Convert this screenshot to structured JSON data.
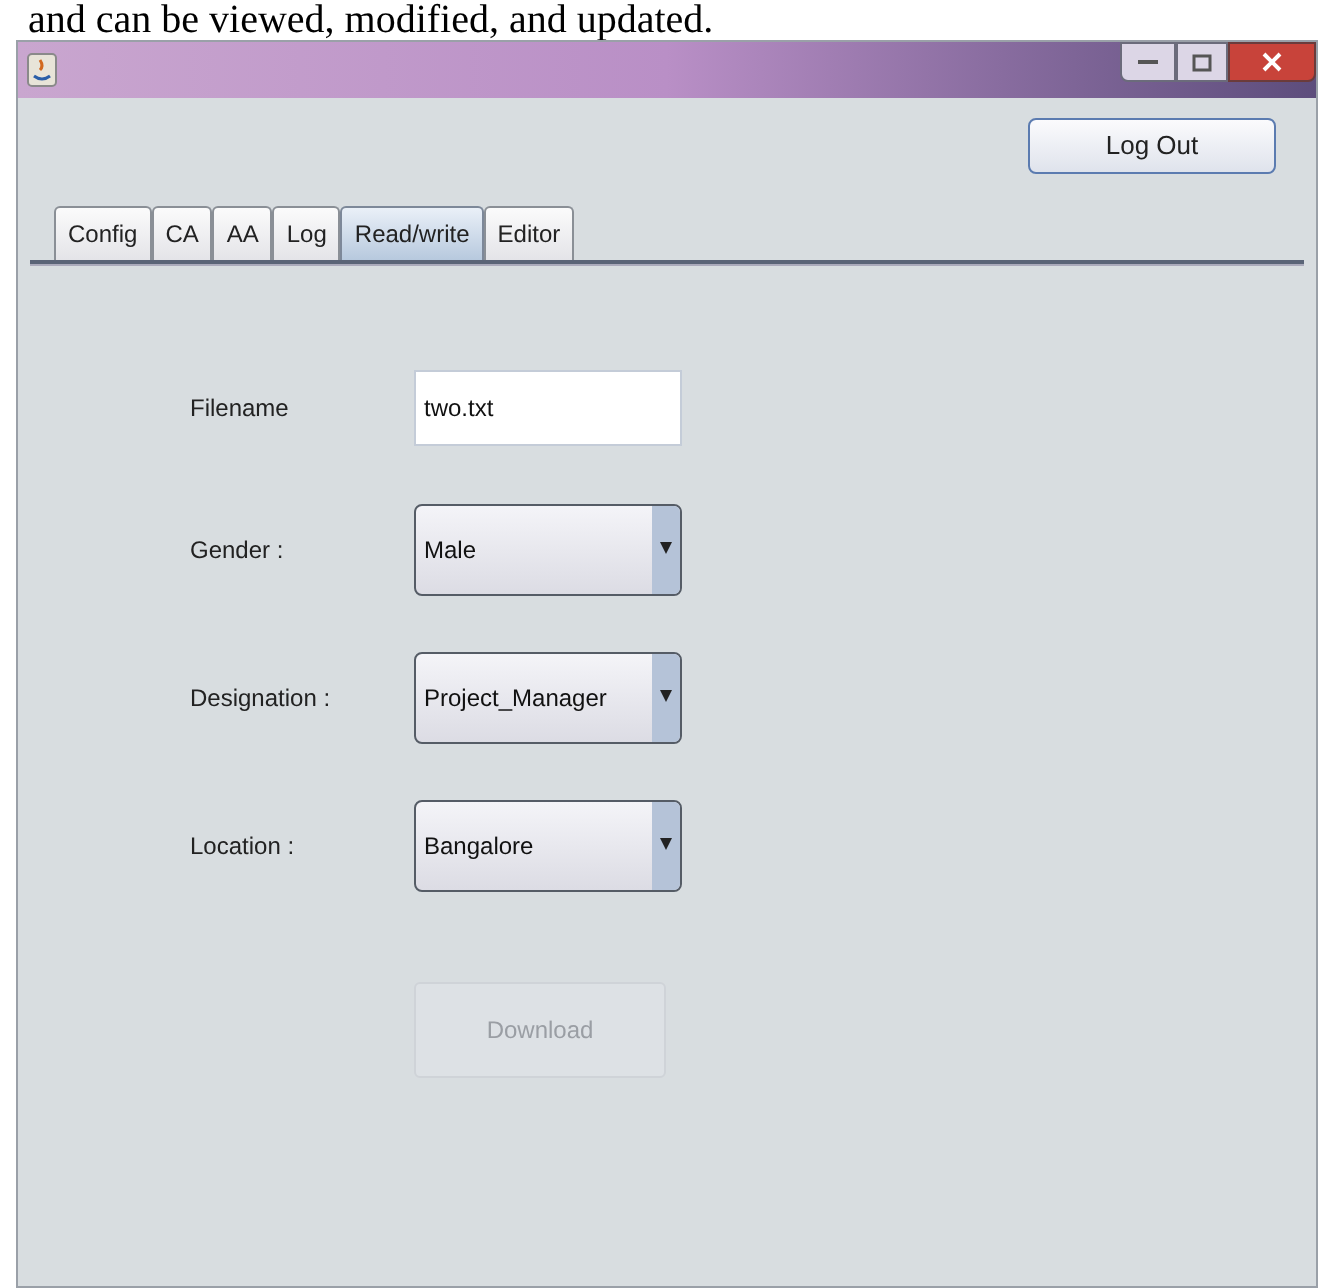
{
  "caption": "and can be viewed, modified, and updated.",
  "logout_button": "Log Out",
  "tabs": [
    {
      "label": "Config",
      "selected": false
    },
    {
      "label": "CA",
      "selected": false
    },
    {
      "label": "AA",
      "selected": false
    },
    {
      "label": "Log",
      "selected": false
    },
    {
      "label": "Read/write",
      "selected": true
    },
    {
      "label": "Editor",
      "selected": false
    }
  ],
  "form": [
    {
      "kind": "text",
      "label": "Filename",
      "value": "two.txt"
    },
    {
      "kind": "dropdown",
      "label": "Gender :",
      "value": "Male"
    },
    {
      "kind": "dropdown",
      "label": "Designation :",
      "value": "Project_Manager"
    },
    {
      "kind": "dropdown",
      "label": "Location :",
      "value": "Bangalore"
    }
  ],
  "download_button": {
    "label": "Download",
    "disabled": true
  }
}
